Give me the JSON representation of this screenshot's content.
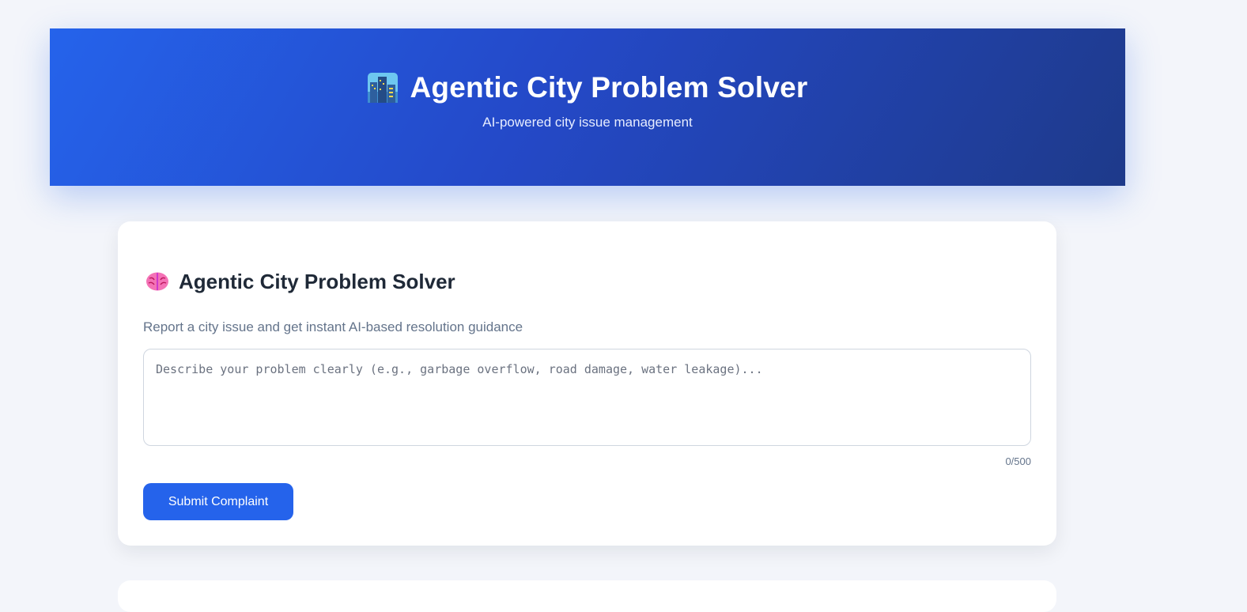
{
  "header": {
    "icon": "cityscape-icon",
    "title": "Agentic City Problem Solver",
    "subtitle": "AI-powered city issue management"
  },
  "form": {
    "icon": "brain-icon",
    "title": "Agentic City Problem Solver",
    "description": "Report a city issue and get instant AI-based resolution guidance",
    "input_value": "",
    "input_placeholder": "Describe your problem clearly (e.g., garbage overflow, road damage, water leakage)...",
    "char_counter": "0/500",
    "submit_label": "Submit Complaint"
  },
  "colors": {
    "accent": "#2563eb",
    "header_gradient_end": "#1e3a8a",
    "page_background": "#f3f5fa"
  }
}
